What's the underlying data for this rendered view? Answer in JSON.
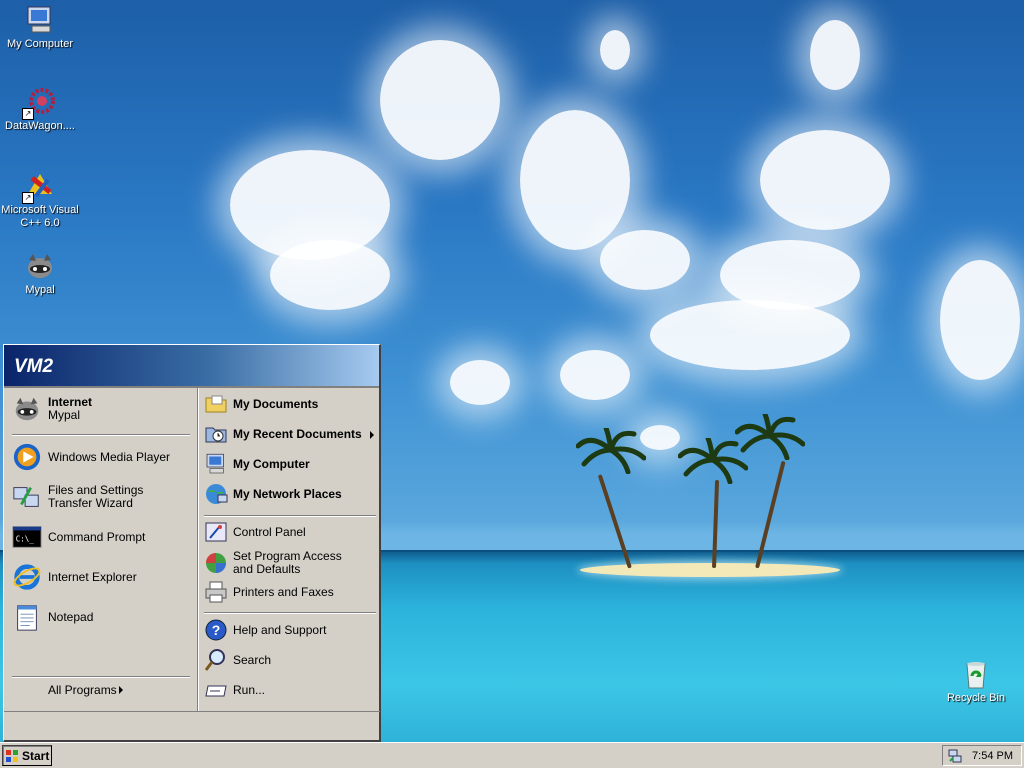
{
  "desktop": {
    "icons": [
      {
        "label": "My Computer",
        "icon": "my-computer-icon"
      },
      {
        "label": "DataWagon....",
        "icon": "datawagon-icon"
      },
      {
        "label": "Microsoft Visual C++ 6.0",
        "icon": "visual-cpp-icon"
      },
      {
        "label": "Mypal",
        "icon": "mypal-icon"
      },
      {
        "label": "Recycle Bin",
        "icon": "recycle-bin-icon"
      }
    ]
  },
  "start_menu": {
    "user_name": "VM2",
    "pinned": {
      "title": "Internet",
      "subtitle": "Mypal"
    },
    "recent_programs": [
      {
        "label": "Windows Media Player",
        "icon": "media-player-icon"
      },
      {
        "label": "Files and Settings Transfer Wizard",
        "icon": "transfer-wizard-icon"
      },
      {
        "label": "Command Prompt",
        "icon": "command-prompt-icon"
      },
      {
        "label": "Internet Explorer",
        "icon": "internet-explorer-icon"
      },
      {
        "label": "Notepad",
        "icon": "notepad-icon"
      }
    ],
    "all_programs": "All Programs",
    "places": [
      {
        "label": "My Documents",
        "icon": "folder-icon"
      },
      {
        "label": "My Recent Documents",
        "icon": "recent-documents-icon"
      },
      {
        "label": "My Computer",
        "icon": "my-computer-icon"
      },
      {
        "label": "My Network Places",
        "icon": "network-icon"
      }
    ],
    "settings": [
      {
        "label": "Control Panel",
        "icon": "control-panel-icon"
      },
      {
        "label": "Set Program Access and Defaults",
        "icon": "program-access-icon"
      },
      {
        "label": "Printers and Faxes",
        "icon": "printer-icon"
      }
    ],
    "help": [
      {
        "label": "Help and Support",
        "icon": "help-icon"
      },
      {
        "label": "Search",
        "icon": "search-icon"
      },
      {
        "label": "Run...",
        "icon": "run-icon"
      }
    ]
  },
  "taskbar": {
    "start_label": "Start",
    "clock": "7:54 PM"
  }
}
